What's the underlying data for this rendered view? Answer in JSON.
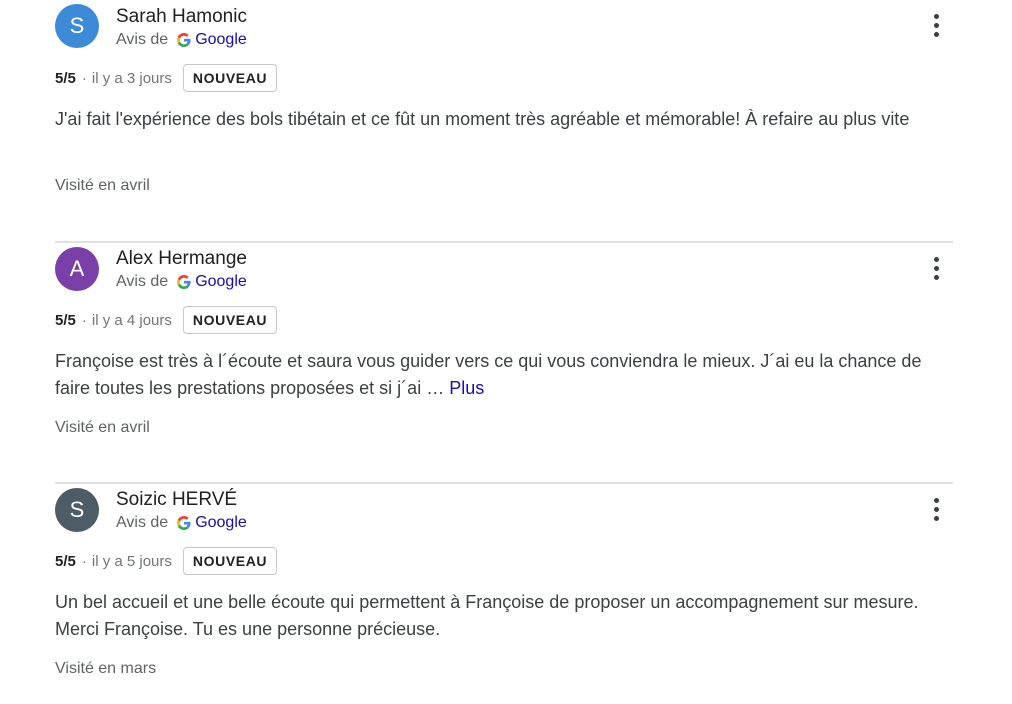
{
  "reviews": [
    {
      "avatar_letter": "S",
      "avatar_color": "#3d8bd8",
      "author": "Sarah Hamonic",
      "source_prefix": "Avis de",
      "source_icon": "google-g-icon",
      "source_name": "Google",
      "rating": "5/5",
      "separator": "·",
      "date": "il y a 3 jours",
      "badge": "NOUVEAU",
      "text": "J'ai fait l'expérience des bols tibétain et ce fût un moment très agréable et mémorable! À refaire au plus vite",
      "more": "",
      "visited": "Visité en avril"
    },
    {
      "avatar_letter": "A",
      "avatar_color": "#7b3fa8",
      "author": "Alex Hermange",
      "source_prefix": "Avis de",
      "source_icon": "google-g-icon",
      "source_name": "Google",
      "rating": "5/5",
      "separator": "·",
      "date": "il y a 4 jours",
      "badge": "NOUVEAU",
      "text": "Françoise est très à l´écoute et saura vous guider vers ce qui vous conviendra le mieux. J´ai eu la chance de faire toutes les prestations proposées et si j´ai … ",
      "more": "Plus",
      "visited": "Visité en avril"
    },
    {
      "avatar_letter": "S",
      "avatar_color": "#4d5c66",
      "author": "Soizic HERVÉ",
      "source_prefix": "Avis de",
      "source_icon": "google-g-icon",
      "source_name": "Google",
      "rating": "5/5",
      "separator": "·",
      "date": "il y a 5 jours",
      "badge": "NOUVEAU",
      "text": "Un bel accueil et une belle écoute qui permettent à Françoise de proposer un accompagnement sur mesure. Merci Françoise. Tu es une personne précieuse.",
      "more": "",
      "visited": "Visité en mars"
    }
  ]
}
